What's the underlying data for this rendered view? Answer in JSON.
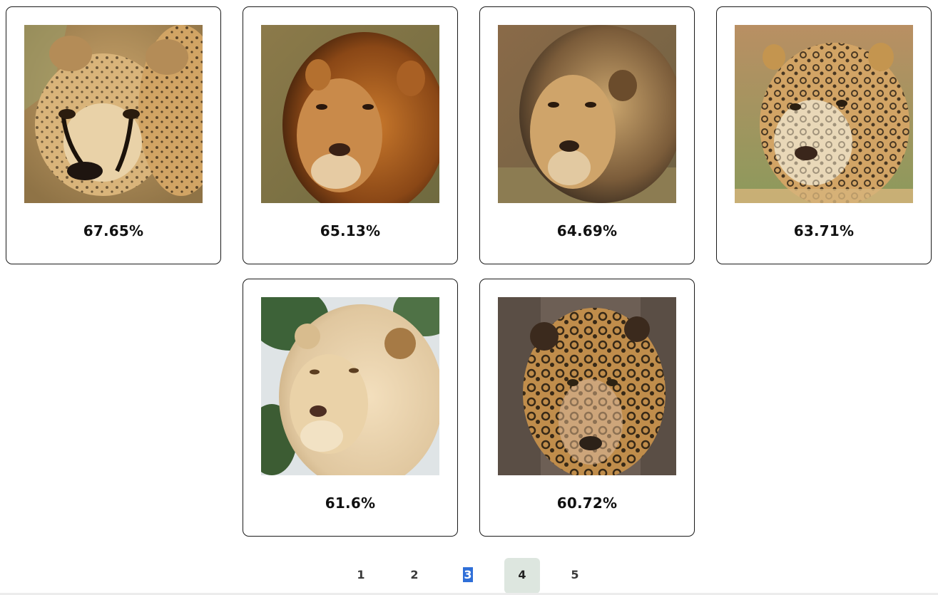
{
  "results": [
    {
      "animal": "cheetah",
      "score": "67.65%"
    },
    {
      "animal": "lion",
      "score": "65.13%"
    },
    {
      "animal": "lion",
      "score": "64.69%"
    },
    {
      "animal": "jaguar",
      "score": "63.71%"
    },
    {
      "animal": "white-lion",
      "score": "61.6%"
    },
    {
      "animal": "jaguar",
      "score": "60.72%"
    }
  ],
  "pagination": {
    "pages": [
      "1",
      "2",
      "3",
      "4",
      "5"
    ],
    "current": "4",
    "highlighted_text": "3"
  },
  "colors": {
    "card_border": "#1a1a1a",
    "active_page_bg": "#dde6df",
    "selection_highlight": "#2f6fd8"
  }
}
